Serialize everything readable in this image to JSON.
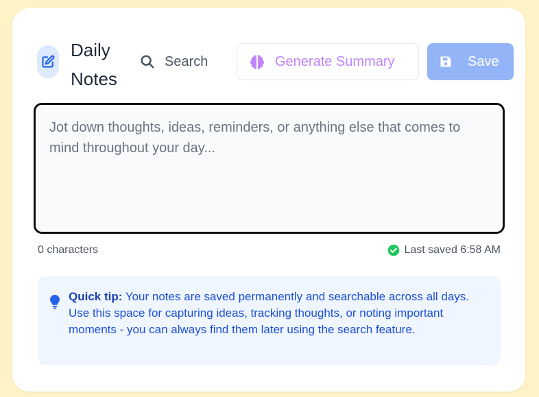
{
  "header": {
    "title": "Daily Notes",
    "title_icon": "edit-icon",
    "search_label": "Search",
    "summary_label": "Generate Summary",
    "summary_icon": "brain-icon",
    "save_label": "Save",
    "save_icon": "floppy-disk-icon"
  },
  "editor": {
    "placeholder": "Jot down thoughts, ideas, reminders, or anything else that comes to mind throughout your day...",
    "value": ""
  },
  "meta": {
    "char_count": "0 characters",
    "last_saved": "Last saved 6:58 AM",
    "saved_icon": "check-circle-icon"
  },
  "tip": {
    "label": "Quick tip:",
    "text": " Your notes are saved permanently and searchable across all days. Use this space for capturing ideas, tracking thoughts, or noting important moments - you can always find them later using the search feature.",
    "icon": "lightbulb-icon"
  },
  "colors": {
    "page_bg": "#fef3c7",
    "accent_blue": "#2563eb",
    "summary_purple": "#c084fc",
    "save_bg": "#93b4f7",
    "success_green": "#22c55e",
    "tip_bg": "#eff6ff"
  }
}
